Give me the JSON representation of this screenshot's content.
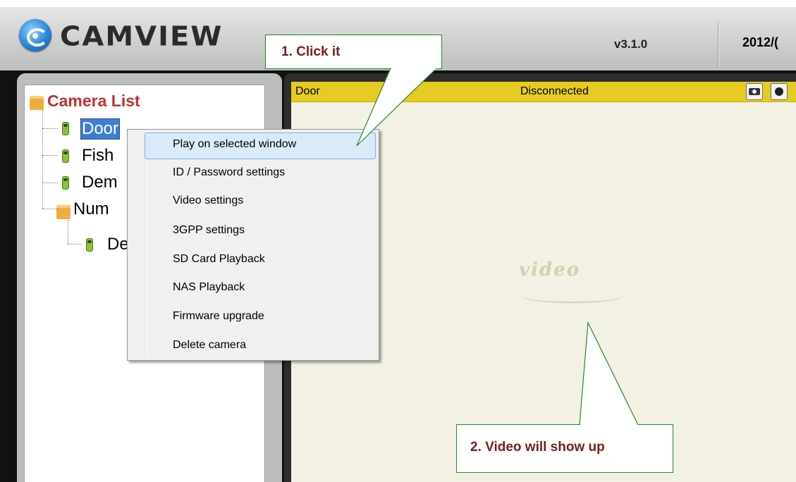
{
  "app": {
    "title": "CAMVIEW",
    "version": "v3.1.0",
    "date": "2012/("
  },
  "tree": {
    "root_label": "Camera List",
    "items": [
      {
        "label": "Door",
        "selected": true
      },
      {
        "label": "Fish"
      },
      {
        "label": "Dem"
      },
      {
        "label": "Num"
      },
      {
        "label": "De"
      }
    ]
  },
  "video": {
    "camera_name": "Door",
    "status": "Disconnected",
    "watermark": "video"
  },
  "context_menu": {
    "items": [
      "Play on selected window",
      "ID / Password settings",
      "Video settings",
      "3GPP settings",
      "SD Card Playback",
      "NAS Playback",
      "Firmware upgrade",
      "Delete camera"
    ],
    "highlighted_index": 0
  },
  "callouts": {
    "step1": "1.   Click it",
    "step2": "2. Video will show up"
  },
  "colors": {
    "video_status_bar": "#e5cb22",
    "tree_root": "#c23131",
    "callout_text": "#7a1d1d",
    "callout_border": "#268a24",
    "selection": "#3c7fd6"
  }
}
